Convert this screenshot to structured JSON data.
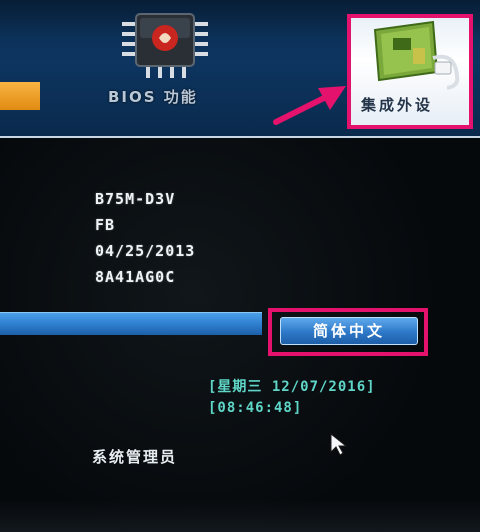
{
  "tabs": {
    "bios_features": {
      "label": "BIOS 功能",
      "icon": "chip-icon"
    },
    "peripherals": {
      "label": "集成外设",
      "icon": "circuit-board-icon",
      "highlighted": true
    }
  },
  "system_info": {
    "model": "B75M-D3V",
    "bios_version": "FB",
    "bios_date": "04/25/2013",
    "bios_id": "8A41AG0C"
  },
  "language": {
    "current": "简体中文"
  },
  "datetime": {
    "date": "[星期三 12/07/2016]",
    "time": "[08:46:48]"
  },
  "access_level": "系统管理员",
  "colors": {
    "highlight_frame": "#e4126c",
    "accent_blue": "#2f7fd0",
    "datetime_text": "#5fd6c7",
    "orange_tab": "#f0a02a"
  }
}
